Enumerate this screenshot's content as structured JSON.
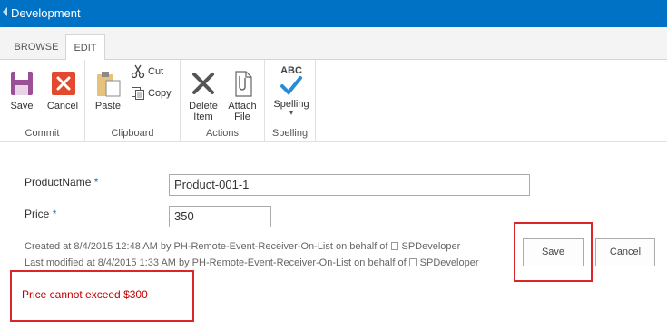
{
  "suitebar": {
    "title": "Development"
  },
  "ribbon": {
    "tabs": [
      {
        "label": "BROWSE"
      },
      {
        "label": "EDIT"
      }
    ],
    "groups": {
      "commit": {
        "label": "Commit",
        "save": "Save",
        "cancel": "Cancel"
      },
      "clipboard": {
        "label": "Clipboard",
        "paste": "Paste",
        "cut": "Cut",
        "copy": "Copy"
      },
      "actions": {
        "label": "Actions",
        "delete_line1": "Delete",
        "delete_line2": "Item",
        "attach_line1": "Attach",
        "attach_line2": "File"
      },
      "spelling": {
        "label": "Spelling",
        "abc": "ABC",
        "spelling": "Spelling"
      }
    }
  },
  "form": {
    "product_name": {
      "label": "ProductName",
      "required_mark": "*",
      "value": "Product-001-1"
    },
    "price": {
      "label": "Price",
      "required_mark": "*",
      "value": "350"
    },
    "created": {
      "prefix": "Created at 8/4/2015 12:48 AM  by PH-Remote-Event-Receiver-On-List on behalf of",
      "user": "SPDeveloper"
    },
    "modified": {
      "prefix": "Last modified at 8/4/2015 1:33 AM  by PH-Remote-Event-Receiver-On-List on behalf of",
      "user": "SPDeveloper"
    },
    "save_label": "Save",
    "cancel_label": "Cancel",
    "error_message": "Price cannot exceed $300"
  },
  "colors": {
    "suitebar": "#0072c6",
    "highlight": "#d9262b",
    "error_text": "#c00000",
    "required": "#0072c6"
  }
}
